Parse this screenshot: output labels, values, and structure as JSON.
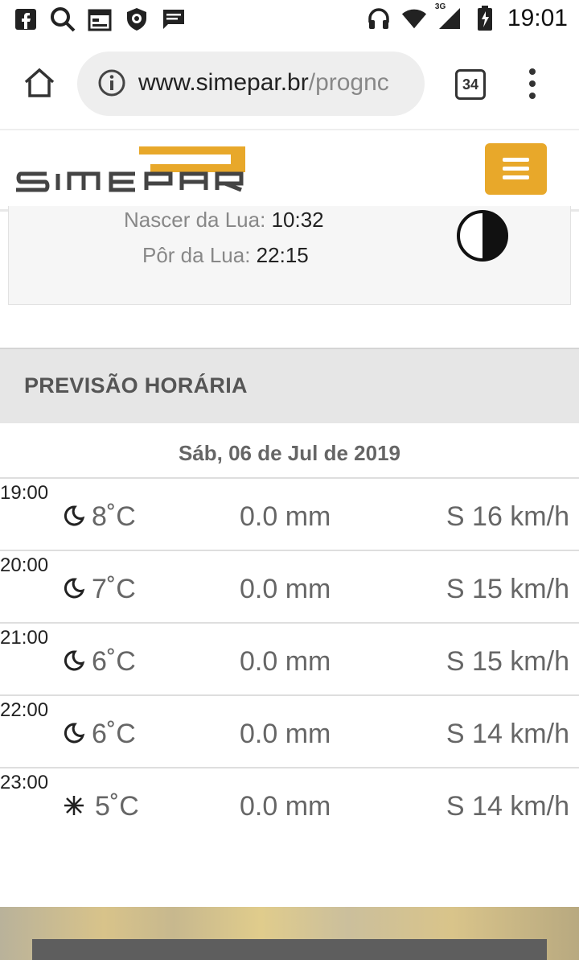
{
  "status_bar": {
    "time": "19:01",
    "network": "3G",
    "left_icons": [
      "facebook-icon",
      "search-icon",
      "calendar-icon",
      "shield-icon",
      "message-icon"
    ],
    "right_icons": [
      "headphones-icon",
      "wifi-icon",
      "signal-icon",
      "battery-icon"
    ]
  },
  "browser": {
    "url_host": "www.simepar.br",
    "url_path": "/prognc",
    "tab_count": "34"
  },
  "site": {
    "brand": "SIMEPAR",
    "brand_color": "#e8a82a"
  },
  "moon": {
    "rise_label": "Nascer da Lua:",
    "rise_time": "10:32",
    "set_label": "Pôr da Lua:",
    "set_time": "22:15"
  },
  "forecast": {
    "section_title": "PREVISÃO HORÁRIA",
    "date": "Sáb, 06 de Jul de 2019",
    "rows": [
      {
        "time": "19:00",
        "icon": "moon-icon",
        "temp": "8˚C",
        "rain": "0.0 mm",
        "wind": "S 16 km/h"
      },
      {
        "time": "20:00",
        "icon": "moon-icon",
        "temp": "7˚C",
        "rain": "0.0 mm",
        "wind": "S 15 km/h"
      },
      {
        "time": "21:00",
        "icon": "moon-icon",
        "temp": "6˚C",
        "rain": "0.0 mm",
        "wind": "S 15 km/h"
      },
      {
        "time": "22:00",
        "icon": "moon-icon",
        "temp": "6˚C",
        "rain": "0.0 mm",
        "wind": "S 14 km/h"
      },
      {
        "time": "23:00",
        "icon": "snowflake-icon",
        "temp": "5˚C",
        "rain": "0.0 mm",
        "wind": "S 14 km/h"
      }
    ]
  }
}
